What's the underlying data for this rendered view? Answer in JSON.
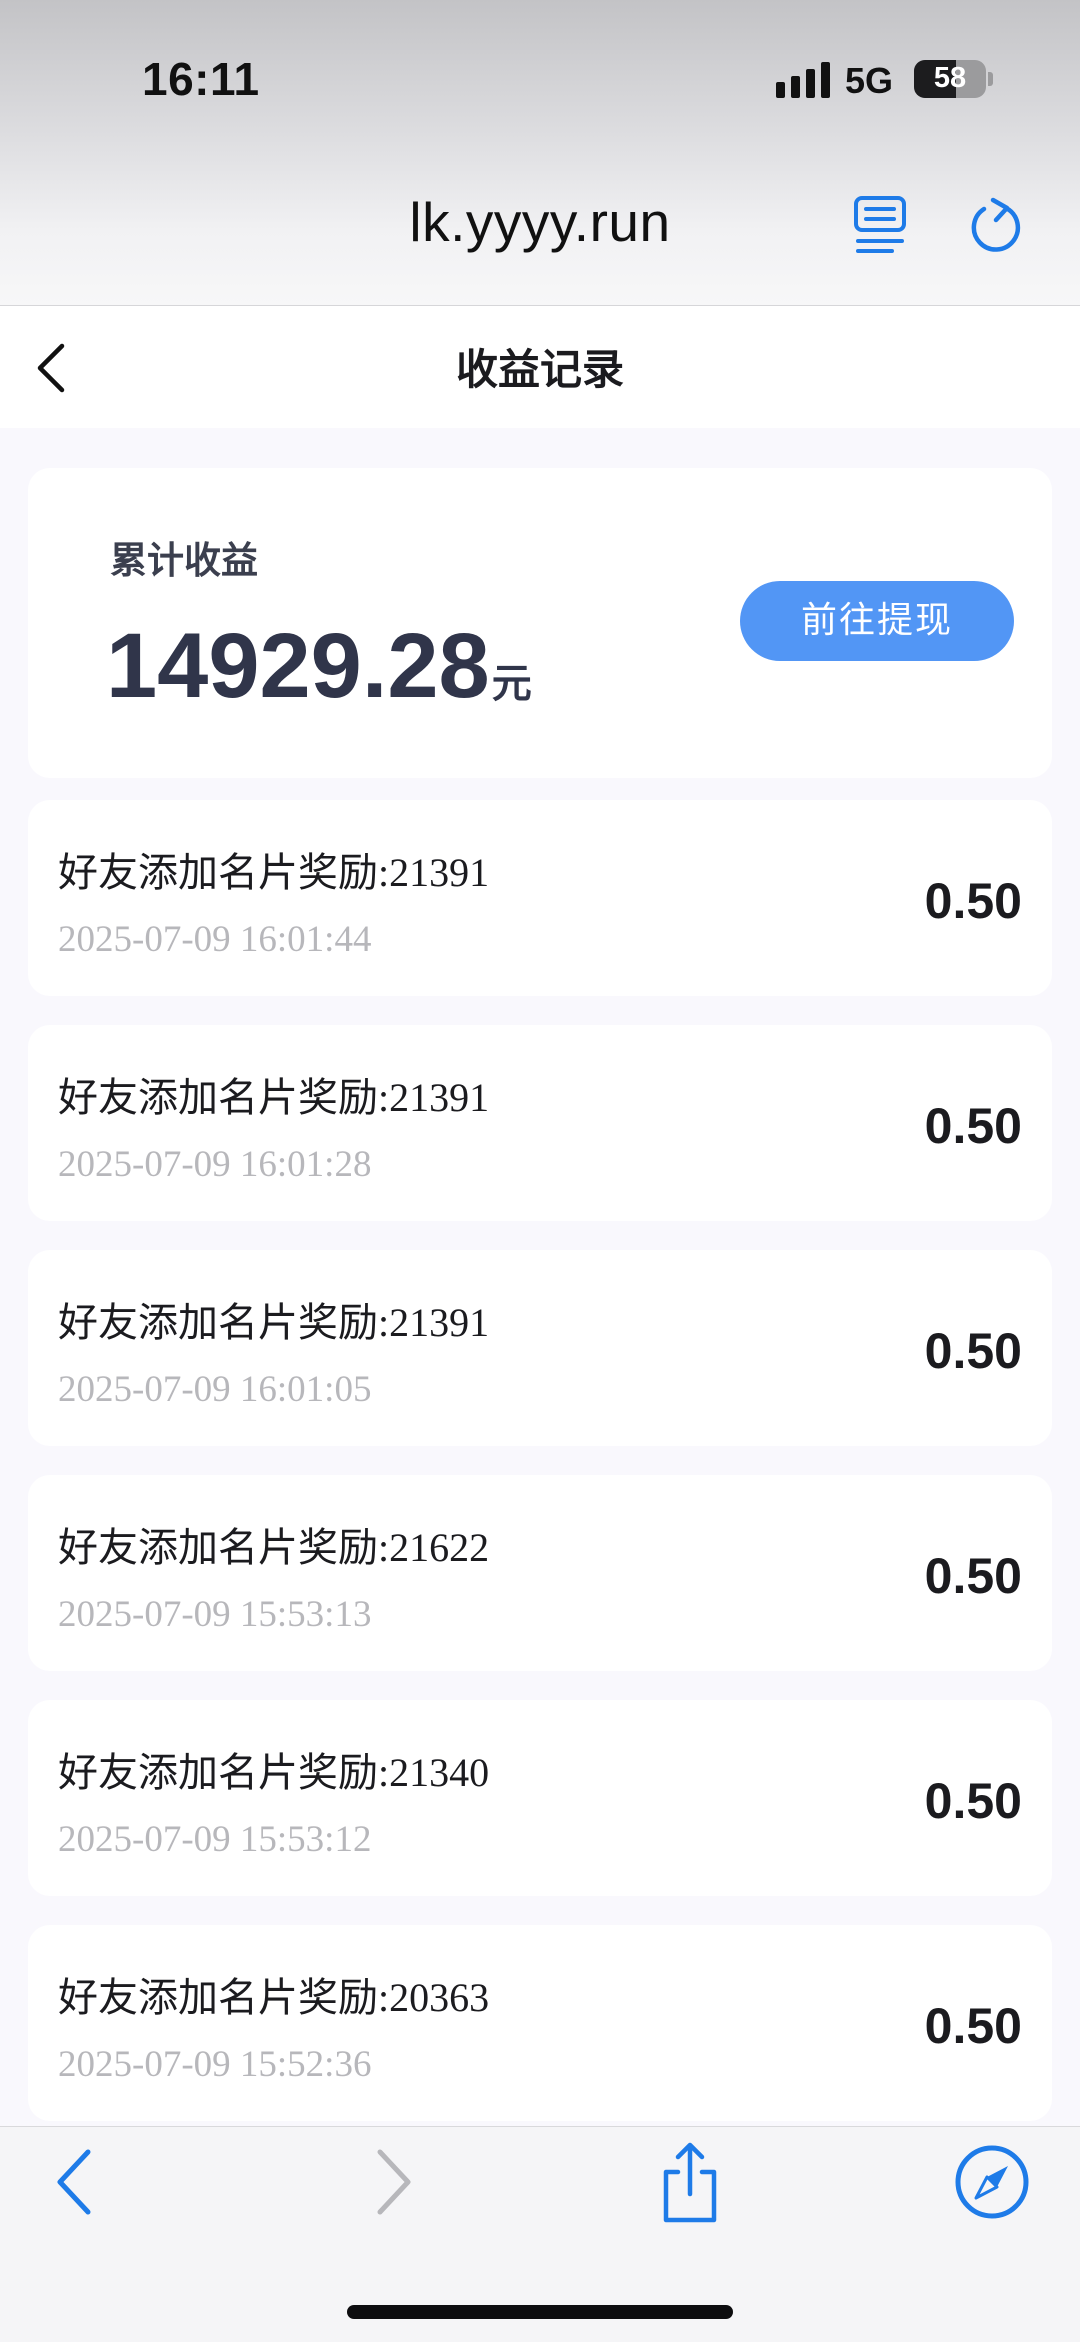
{
  "status_bar": {
    "time": "16:11",
    "network": "5G",
    "battery": "58",
    "battery_level": 0.58
  },
  "browser": {
    "url": "lk.yyyy.run",
    "icons": {
      "reader": "reader-mode-icon",
      "reload": "reload-icon",
      "back": "back-arrow-icon",
      "forward": "forward-arrow-icon",
      "share": "share-icon",
      "compass": "compass-icon"
    },
    "accent_color": "#1e7be8"
  },
  "header": {
    "title": "收益记录",
    "back_icon": "chevron-left-icon"
  },
  "summary": {
    "label": "累计收益",
    "amount": "14929.28",
    "unit": "元",
    "withdraw_label": "前往提现",
    "button_color": "#5296f5"
  },
  "records": [
    {
      "title": "好友添加名片奖励:21391",
      "time": "2025-07-09 16:01:44",
      "amount": "0.50"
    },
    {
      "title": "好友添加名片奖励:21391",
      "time": "2025-07-09 16:01:28",
      "amount": "0.50"
    },
    {
      "title": "好友添加名片奖励:21391",
      "time": "2025-07-09 16:01:05",
      "amount": "0.50"
    },
    {
      "title": "好友添加名片奖励:21622",
      "time": "2025-07-09 15:53:13",
      "amount": "0.50"
    },
    {
      "title": "好友添加名片奖励:21340",
      "time": "2025-07-09 15:53:12",
      "amount": "0.50"
    },
    {
      "title": "好友添加名片奖励:20363",
      "time": "2025-07-09 15:52:36",
      "amount": "0.50"
    }
  ]
}
